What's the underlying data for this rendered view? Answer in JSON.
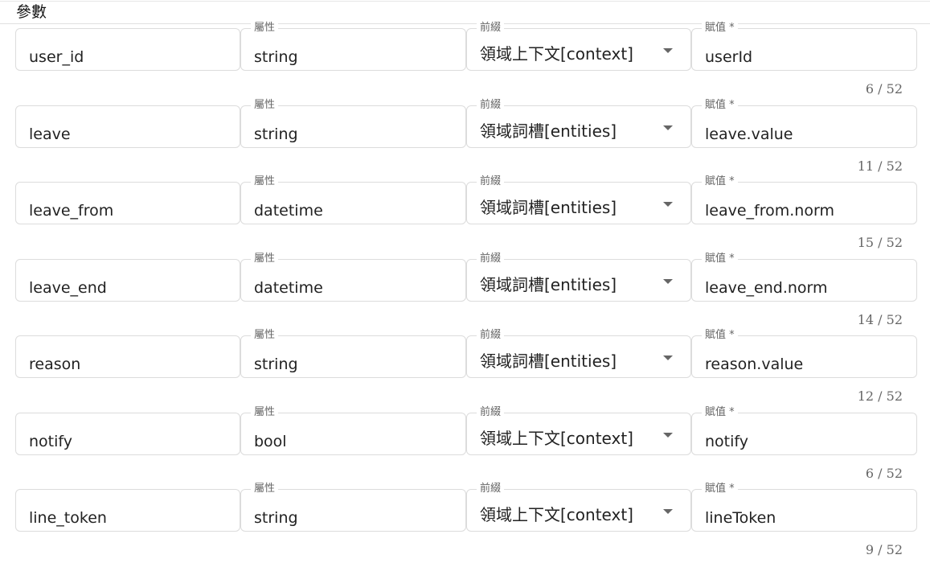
{
  "section": {
    "title": "參數"
  },
  "labels": {
    "type": "屬性",
    "prefix": "前綴",
    "assign": "賦值 *"
  },
  "params": [
    {
      "name": "user_id",
      "type": "string",
      "prefix": "領域上下文[context]",
      "assign": "userId",
      "counter": "6 / 52"
    },
    {
      "name": "leave",
      "type": "string",
      "prefix": "領域詞槽[entities]",
      "assign": "leave.value",
      "counter": "11 / 52"
    },
    {
      "name": "leave_from",
      "type": "datetime",
      "prefix": "領域詞槽[entities]",
      "assign": "leave_from.norm",
      "counter": "15 / 52"
    },
    {
      "name": "leave_end",
      "type": "datetime",
      "prefix": "領域詞槽[entities]",
      "assign": "leave_end.norm",
      "counter": "14 / 52"
    },
    {
      "name": "reason",
      "type": "string",
      "prefix": "領域詞槽[entities]",
      "assign": "reason.value",
      "counter": "12 / 52"
    },
    {
      "name": "notify",
      "type": "bool",
      "prefix": "領域上下文[context]",
      "assign": "notify",
      "counter": "6 / 52"
    },
    {
      "name": "line_token",
      "type": "string",
      "prefix": "領域上下文[context]",
      "assign": "lineToken",
      "counter": "9 / 52"
    }
  ]
}
